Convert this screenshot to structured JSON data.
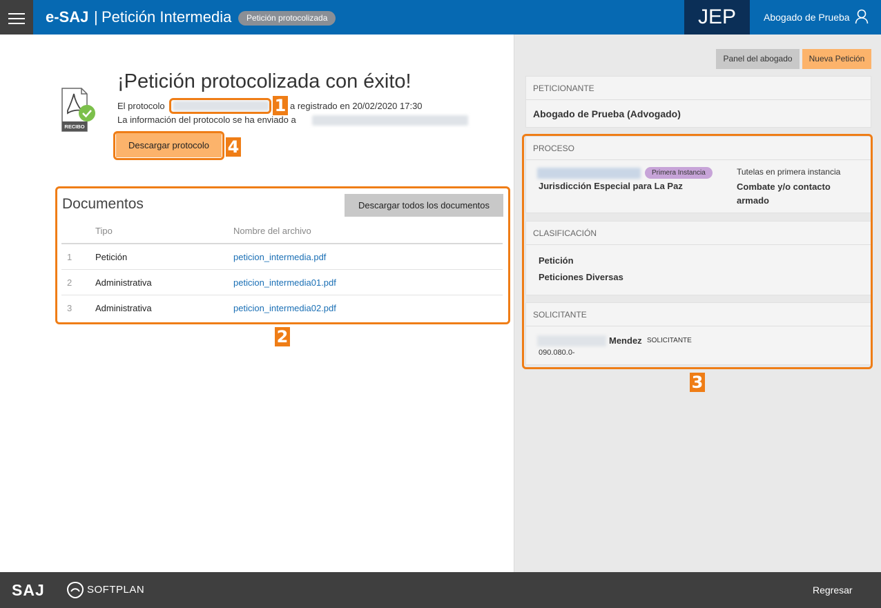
{
  "header": {
    "brand": "e-SAJ",
    "separator": "|",
    "title": "Petición Intermedia",
    "status_badge": "Petición protocolizada",
    "org": "JEP",
    "user_name": "Abogado de Prueba"
  },
  "success": {
    "title": "¡Petición protocolizada con éxito!",
    "protocol_prefix": "El protocolo",
    "protocol_suffix": "a registrado en 20/02/2020 17:30",
    "info_text": "La información del protocolo se ha enviado a",
    "download_button": "Descargar protocolo",
    "icon_label": "RECIBO"
  },
  "documents": {
    "title": "Documentos",
    "download_all_button": "Descargar todos los documentos",
    "columns": [
      "Tipo",
      "Nombre del archivo"
    ],
    "rows": [
      {
        "num": "1",
        "tipo": "Petición",
        "file": "peticion_intermedia.pdf"
      },
      {
        "num": "2",
        "tipo": "Administrativa",
        "file": "peticion_intermedia01.pdf"
      },
      {
        "num": "3",
        "tipo": "Administrativa",
        "file": "peticion_intermedia02.pdf"
      }
    ]
  },
  "side": {
    "panel_button": "Panel del abogado",
    "new_button": "Nueva Petición",
    "peticionante": {
      "header": "PETICIONANTE",
      "name": "Abogado de Prueba (Advogado)"
    },
    "proceso": {
      "header": "PROCESO",
      "instance_badge": "Primera Instancia",
      "jurisdiction": "Jurisdicción Especial para La Paz",
      "tutela": "Tutelas en primera instancia",
      "subject": "Combate y/o contacto armado"
    },
    "clasificacion": {
      "header": "CLASIFICACIÓN",
      "line1": "Petición",
      "line2": "Peticiones Diversas"
    },
    "solicitante": {
      "header": "SOLICITANTE",
      "name": "Mendez",
      "role": "SOLICITANTE",
      "number": "090.080.0-"
    }
  },
  "annotations": [
    "1",
    "2",
    "3",
    "4"
  ],
  "footer": {
    "logo": "SAJ",
    "company": "SOFTPLAN",
    "back": "Regresar"
  },
  "colors": {
    "header_blue": "#0669b2",
    "org_navy": "#0b2f57",
    "accent_orange": "#ef7d16",
    "button_orange": "#fcb36b",
    "link_blue": "#1a6fb5",
    "footer_gray": "#3f3f3f"
  }
}
